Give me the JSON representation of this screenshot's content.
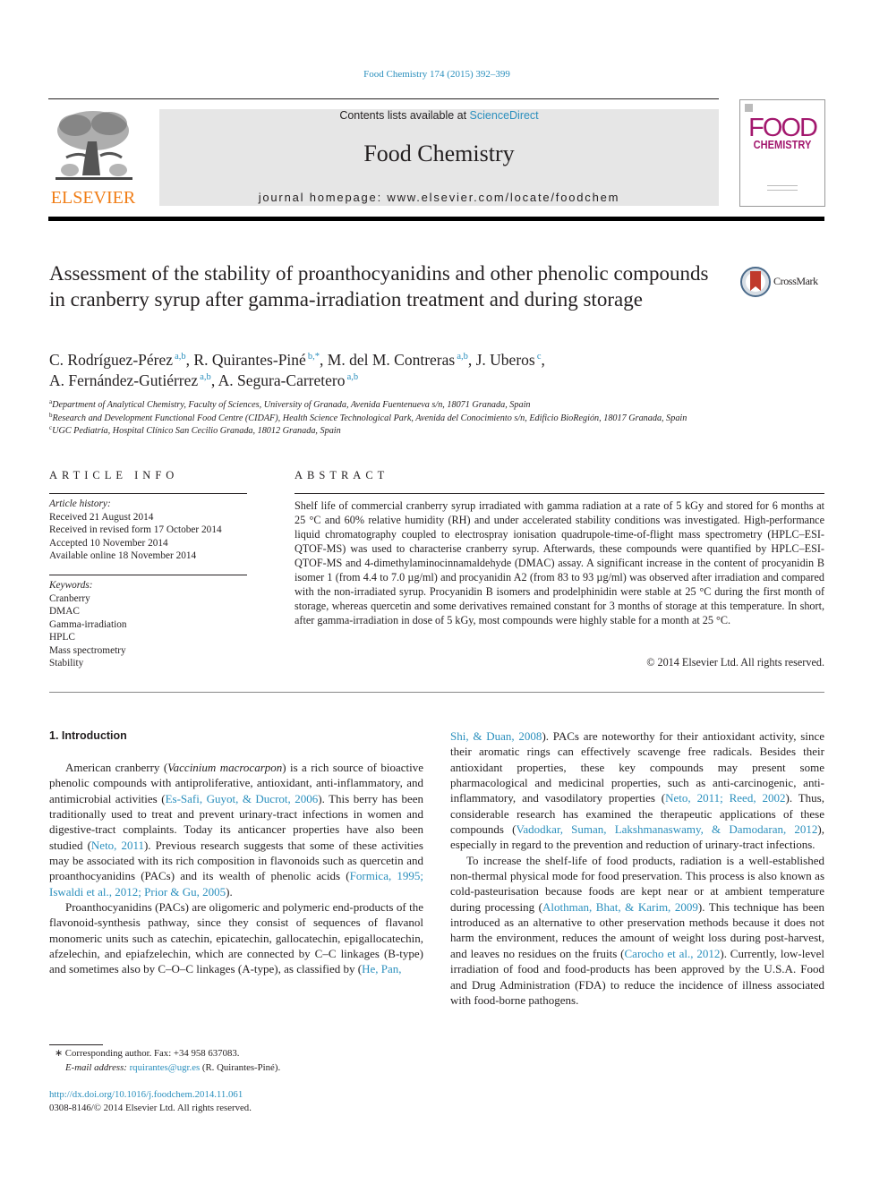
{
  "header": {
    "journal_ref": "Food Chemistry 174 (2015) 392–399",
    "contents_prefix": "Contents lists available at ",
    "contents_link": "ScienceDirect",
    "journal_title": "Food Chemistry",
    "homepage": "journal homepage: www.elsevier.com/locate/foodchem",
    "publisher_logo_text": "ELSEVIER",
    "cover_word1": "FOOD",
    "cover_word2": "CHEMISTRY",
    "crossmark_label": "CrossMark"
  },
  "article": {
    "title": "Assessment of the stability of proanthocyanidins and other phenolic compounds in cranberry syrup after gamma-irradiation treatment and during storage",
    "authors": [
      {
        "name": "C. Rodríguez-Pérez",
        "sup": "a,b",
        "sep": ", "
      },
      {
        "name": "R. Quirantes-Piné",
        "sup": "b,*",
        "sep": ", "
      },
      {
        "name": "M. del M. Contreras",
        "sup": "a,b",
        "sep": ", "
      },
      {
        "name": "J. Uberos",
        "sup": "c",
        "sep": ","
      },
      {
        "name": "A. Fernández-Gutiérrez",
        "sup": "a,b",
        "sep": ", "
      },
      {
        "name": "A. Segura-Carretero",
        "sup": "a,b",
        "sep": ""
      }
    ],
    "affiliations": [
      {
        "mark": "a",
        "text": "Department of Analytical Chemistry, Faculty of Sciences, University of Granada, Avenida Fuentenueva s/n, 18071 Granada, Spain"
      },
      {
        "mark": "b",
        "text": "Research and Development Functional Food Centre (CIDAF), Health Science Technological Park, Avenida del Conocimiento s/n, Edificio BioRegión, 18017 Granada, Spain"
      },
      {
        "mark": "c",
        "text": "UGC Pediatría, Hospital Clínico San Cecilio Granada, 18012 Granada, Spain"
      }
    ]
  },
  "article_info": {
    "heading": "ARTICLE INFO",
    "history_label": "Article history:",
    "history": [
      "Received 21 August 2014",
      "Received in revised form 17 October 2014",
      "Accepted 10 November 2014",
      "Available online 18 November 2014"
    ],
    "keywords_label": "Keywords:",
    "keywords": [
      "Cranberry",
      "DMAC",
      "Gamma-irradiation",
      "HPLC",
      "Mass spectrometry",
      "Stability"
    ]
  },
  "abstract": {
    "heading": "ABSTRACT",
    "text": "Shelf life of commercial cranberry syrup irradiated with gamma radiation at a rate of 5 kGy and stored for 6 months at 25 °C and 60% relative humidity (RH) and under accelerated stability conditions was investigated. High-performance liquid chromatography coupled to electrospray ionisation quadrupole-time-of-flight mass spectrometry (HPLC–ESI-QTOF-MS) was used to characterise cranberry syrup. Afterwards, these compounds were quantified by HPLC–ESI-QTOF-MS and 4-dimethylaminocinnamaldehyde (DMAC) assay. A significant increase in the content of procyanidin B isomer 1 (from 4.4 to 7.0 µg/ml) and procyanidin A2 (from 83 to 93 µg/ml) was observed after irradiation and compared with the non-irradiated syrup. Procyanidin B isomers and prodelphinidin were stable at 25 °C during the first month of storage, whereas quercetin and some derivatives remained constant for 3 months of storage at this temperature. In short, after gamma-irradiation in dose of 5 kGy, most compounds were highly stable for a month at 25 °C.",
    "copyright": "© 2014 Elsevier Ltd. All rights reserved."
  },
  "body": {
    "section_heading": "1. Introduction",
    "left_paragraphs": [
      [
        {
          "t": "American cranberry ("
        },
        {
          "t": "Vaccinium macrocarpon",
          "style": "italic"
        },
        {
          "t": ") is a rich source of bioactive phenolic compounds with antiproliferative, antioxidant, anti-inflammatory, and antimicrobial activities ("
        },
        {
          "t": "Es-Safi, Guyot, & Ducrot, 2006",
          "style": "link"
        },
        {
          "t": "). This berry has been traditionally used to treat and prevent urinary-tract infections in women and digestive-tract complaints. Today its anticancer properties have also been studied ("
        },
        {
          "t": "Neto, 2011",
          "style": "link"
        },
        {
          "t": "). Previous research suggests that some of these activities may be associated with its rich composition in flavonoids such as quercetin and proanthocyanidins (PACs) and its wealth of phenolic acids ("
        },
        {
          "t": "Formica, 1995; Iswaldi et al., 2012; Prior & Gu, 2005",
          "style": "link"
        },
        {
          "t": ")."
        }
      ],
      [
        {
          "t": "Proanthocyanidins (PACs) are oligomeric and polymeric end-products of the flavonoid-synthesis pathway, since they consist of sequences of flavanol monomeric units such as catechin, epicatechin, gallocatechin, epigallocatechin, afzelechin, and epiafzelechin, which are connected by C–C linkages (B-type) and sometimes also by C–O–C linkages (A-type), as classified by ("
        },
        {
          "t": "He, Pan,",
          "style": "link"
        }
      ]
    ],
    "right_paragraphs": [
      [
        {
          "t": "Shi, & Duan, 2008",
          "style": "link"
        },
        {
          "t": "). PACs are noteworthy for their antioxidant activity, since their aromatic rings can effectively scavenge free radicals. Besides their antioxidant properties, these key compounds may present some pharmacological and medicinal properties, such as anti-carcinogenic, anti-inflammatory, and vasodilatory properties ("
        },
        {
          "t": "Neto, 2011; Reed, 2002",
          "style": "link"
        },
        {
          "t": "). Thus, considerable research has examined the therapeutic applications of these compounds ("
        },
        {
          "t": "Vadodkar, Suman, Lakshmanaswamy, & Damodaran, 2012",
          "style": "link"
        },
        {
          "t": "), especially in regard to the prevention and reduction of urinary-tract infections."
        }
      ],
      [
        {
          "t": "To increase the shelf-life of food products, radiation is a well-established non-thermal physical mode for food preservation. This process is also known as cold-pasteurisation because foods are kept near or at ambient temperature during processing ("
        },
        {
          "t": "Alothman, Bhat, & Karim, 2009",
          "style": "link"
        },
        {
          "t": "). This technique has been introduced as an alternative to other preservation methods because it does not harm the environment, reduces the amount of weight loss during post-harvest, and leaves no residues on the fruits ("
        },
        {
          "t": "Carocho et al., 2012",
          "style": "link"
        },
        {
          "t": "). Currently, low-level irradiation of food and food-products has been approved by the U.S.A. Food and Drug Administration (FDA) to reduce the incidence of illness associated with food-borne pathogens."
        }
      ]
    ]
  },
  "footnotes": {
    "corresponding": "∗ Corresponding author. Fax: +34 958 637083.",
    "email_label": "E-mail address: ",
    "email": "rquirantes@ugr.es",
    "email_suffix": " (R. Quirantes-Piné).",
    "doi": "http://dx.doi.org/10.1016/j.foodchem.2014.11.061",
    "issn_line": "0308-8146/© 2014 Elsevier Ltd. All rights reserved."
  },
  "colors": {
    "link": "#2a8fbd",
    "elsevier_orange": "#f07d16",
    "cover_magenta": "#a3186e",
    "banner_gray": "#e6e6e6",
    "crossmark_red": "#c0392b"
  }
}
